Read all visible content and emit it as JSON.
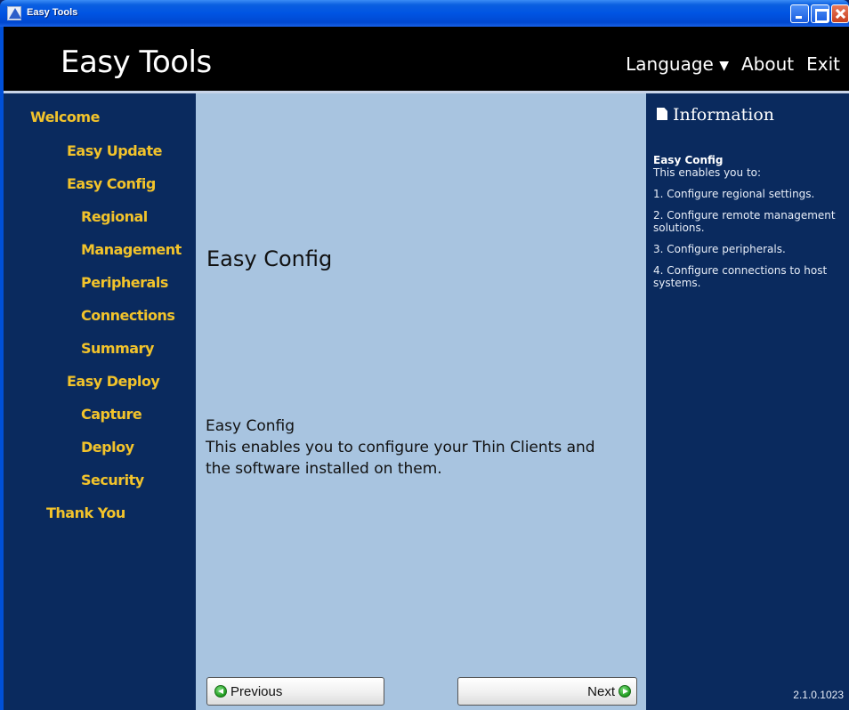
{
  "window": {
    "title": "Easy Tools",
    "controls": [
      "minimize-icon",
      "maximize-icon",
      "close-icon"
    ]
  },
  "header": {
    "title": "Easy Tools",
    "menu": {
      "language": "Language",
      "about": "About",
      "exit": "Exit"
    }
  },
  "sidebar": {
    "items": [
      {
        "label": "Welcome",
        "level": 0
      },
      {
        "label": "Easy Update",
        "level": 1
      },
      {
        "label": "Easy Config",
        "level": 1
      },
      {
        "label": "Regional",
        "level": 2
      },
      {
        "label": "Management",
        "level": 2
      },
      {
        "label": "Peripherals",
        "level": 2
      },
      {
        "label": "Connections",
        "level": 2
      },
      {
        "label": "Summary",
        "level": 2
      },
      {
        "label": "Easy Deploy",
        "level": 1
      },
      {
        "label": "Capture",
        "level": 2
      },
      {
        "label": "Deploy",
        "level": 2
      },
      {
        "label": "Security",
        "level": 2
      },
      {
        "label": "Thank You",
        "level": 1
      }
    ]
  },
  "main": {
    "title": "Easy Config",
    "description": {
      "heading": "Easy Config",
      "line1": "This enables you to configure your Thin Clients and",
      "line2": "the software installed on them."
    },
    "buttons": {
      "previous": "Previous",
      "next": "Next"
    }
  },
  "info": {
    "heading": "Information",
    "subtitle": "Easy Config",
    "intro": "This enables you to:",
    "points": [
      "1. Configure regional settings.",
      "2. Configure remote management solutions.",
      "3. Configure peripherals.",
      "4. Configure connections to host systems."
    ],
    "version": "2.1.0.1023"
  },
  "colors": {
    "accent": "#f2c32b",
    "panel_dark": "#0a2a5e",
    "panel_light": "#a8c4e0",
    "header_bg": "#000000"
  }
}
